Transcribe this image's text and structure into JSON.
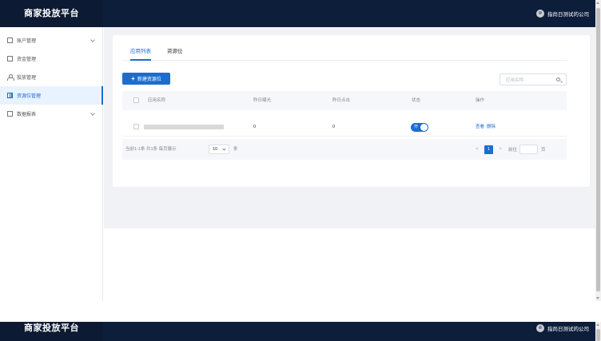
{
  "header": {
    "brand": "商家投放平台",
    "user_name": "指尚日测试的公司"
  },
  "sidebar": {
    "items": [
      {
        "label": "账户管理",
        "icon": "account-icon",
        "expandable": true,
        "active": false
      },
      {
        "label": "资金管理",
        "icon": "fund-icon",
        "expandable": false,
        "active": false
      },
      {
        "label": "投放管理",
        "icon": "person-icon",
        "expandable": false,
        "active": false
      },
      {
        "label": "资源位管理",
        "icon": "grid-icon",
        "expandable": false,
        "active": true
      },
      {
        "label": "数据报表",
        "icon": "report-icon",
        "expandable": true,
        "active": false
      }
    ]
  },
  "tabs": [
    {
      "label": "应用列表",
      "active": true
    },
    {
      "label": "资源位",
      "active": false
    }
  ],
  "toolbar": {
    "new_button_label": "新建资源位",
    "plus_glyph": "+",
    "search_placeholder": "应用名称"
  },
  "table": {
    "columns": [
      "应用名称",
      "昨日曝光",
      "昨日点击",
      "状态",
      "操作"
    ],
    "rows": [
      {
        "exposure": "0",
        "clicks": "0",
        "status_label": "开",
        "actions": [
          "查看",
          "删除"
        ]
      }
    ]
  },
  "pagination": {
    "summary": "当前1-1条 共1条 每页展示",
    "page_size": "10",
    "page_size_unit": "条",
    "prev_glyph": "<",
    "next_glyph": ">",
    "current_page": "1",
    "goto_label": "前往",
    "page_unit": "页"
  },
  "colors": {
    "header_bg": "#0d1e3a",
    "primary": "#1c6dd0",
    "content_bg": "#f0f2f5"
  }
}
